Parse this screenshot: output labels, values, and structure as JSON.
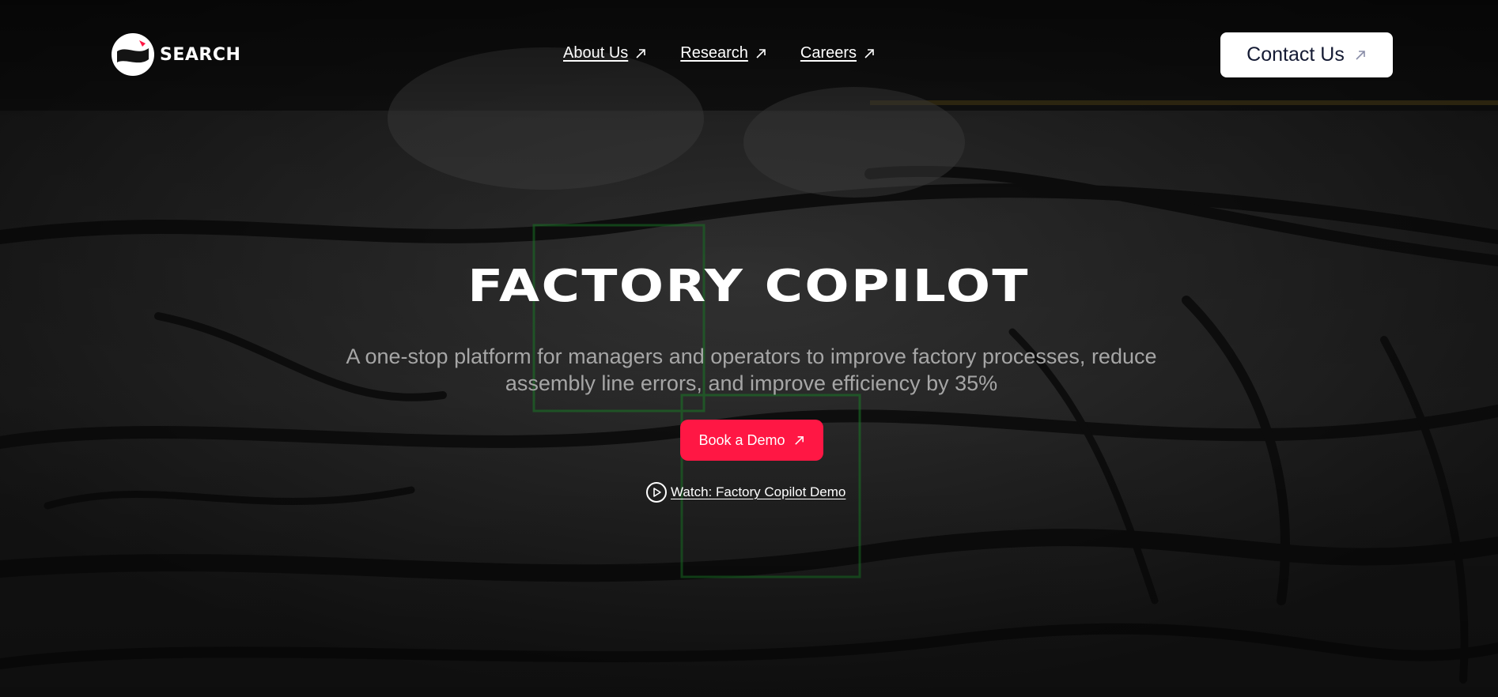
{
  "brand": {
    "name": "SEARCH"
  },
  "nav": {
    "links": [
      {
        "label": "About Us",
        "icon": "arrow-up-right-icon"
      },
      {
        "label": "Research",
        "icon": "arrow-up-right-icon"
      },
      {
        "label": "Careers",
        "icon": "arrow-up-right-icon"
      }
    ],
    "contact_label": "Contact Us"
  },
  "hero": {
    "title": "FACTORY COPILOT",
    "subtitle": "A one-stop platform for managers and operators to improve factory processes, reduce assembly line errors, and improve efficiency by 35%",
    "cta_label": "Book a Demo",
    "video_link_label": "Watch: Factory Copilot Demo",
    "video_icon": "play-circle-icon"
  },
  "colors": {
    "accent": "#ff1744",
    "button_text_dark": "#141a33",
    "subtitle_text": "#a6a6a6",
    "background": "#1b1b1b"
  }
}
